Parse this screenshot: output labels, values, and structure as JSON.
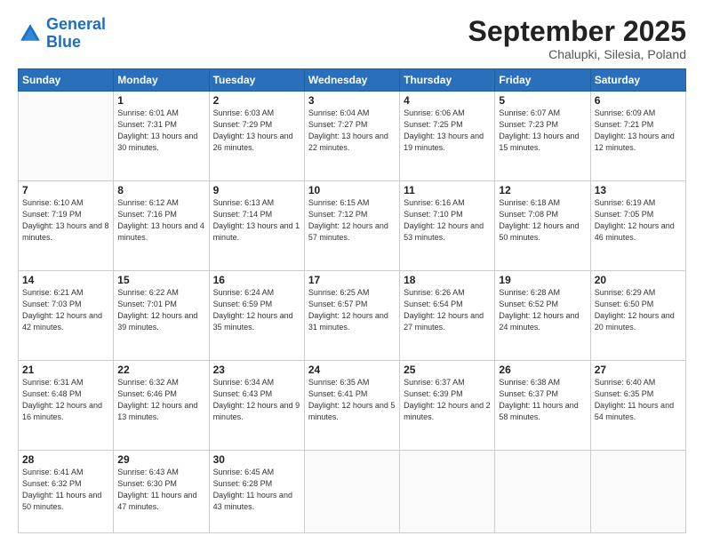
{
  "header": {
    "logo_line1": "General",
    "logo_line2": "Blue",
    "month": "September 2025",
    "location": "Chalupki, Silesia, Poland"
  },
  "weekdays": [
    "Sunday",
    "Monday",
    "Tuesday",
    "Wednesday",
    "Thursday",
    "Friday",
    "Saturday"
  ],
  "weeks": [
    [
      {
        "day": "",
        "sunrise": "",
        "sunset": "",
        "daylight": ""
      },
      {
        "day": "1",
        "sunrise": "Sunrise: 6:01 AM",
        "sunset": "Sunset: 7:31 PM",
        "daylight": "Daylight: 13 hours and 30 minutes."
      },
      {
        "day": "2",
        "sunrise": "Sunrise: 6:03 AM",
        "sunset": "Sunset: 7:29 PM",
        "daylight": "Daylight: 13 hours and 26 minutes."
      },
      {
        "day": "3",
        "sunrise": "Sunrise: 6:04 AM",
        "sunset": "Sunset: 7:27 PM",
        "daylight": "Daylight: 13 hours and 22 minutes."
      },
      {
        "day": "4",
        "sunrise": "Sunrise: 6:06 AM",
        "sunset": "Sunset: 7:25 PM",
        "daylight": "Daylight: 13 hours and 19 minutes."
      },
      {
        "day": "5",
        "sunrise": "Sunrise: 6:07 AM",
        "sunset": "Sunset: 7:23 PM",
        "daylight": "Daylight: 13 hours and 15 minutes."
      },
      {
        "day": "6",
        "sunrise": "Sunrise: 6:09 AM",
        "sunset": "Sunset: 7:21 PM",
        "daylight": "Daylight: 13 hours and 12 minutes."
      }
    ],
    [
      {
        "day": "7",
        "sunrise": "Sunrise: 6:10 AM",
        "sunset": "Sunset: 7:19 PM",
        "daylight": "Daylight: 13 hours and 8 minutes."
      },
      {
        "day": "8",
        "sunrise": "Sunrise: 6:12 AM",
        "sunset": "Sunset: 7:16 PM",
        "daylight": "Daylight: 13 hours and 4 minutes."
      },
      {
        "day": "9",
        "sunrise": "Sunrise: 6:13 AM",
        "sunset": "Sunset: 7:14 PM",
        "daylight": "Daylight: 13 hours and 1 minute."
      },
      {
        "day": "10",
        "sunrise": "Sunrise: 6:15 AM",
        "sunset": "Sunset: 7:12 PM",
        "daylight": "Daylight: 12 hours and 57 minutes."
      },
      {
        "day": "11",
        "sunrise": "Sunrise: 6:16 AM",
        "sunset": "Sunset: 7:10 PM",
        "daylight": "Daylight: 12 hours and 53 minutes."
      },
      {
        "day": "12",
        "sunrise": "Sunrise: 6:18 AM",
        "sunset": "Sunset: 7:08 PM",
        "daylight": "Daylight: 12 hours and 50 minutes."
      },
      {
        "day": "13",
        "sunrise": "Sunrise: 6:19 AM",
        "sunset": "Sunset: 7:05 PM",
        "daylight": "Daylight: 12 hours and 46 minutes."
      }
    ],
    [
      {
        "day": "14",
        "sunrise": "Sunrise: 6:21 AM",
        "sunset": "Sunset: 7:03 PM",
        "daylight": "Daylight: 12 hours and 42 minutes."
      },
      {
        "day": "15",
        "sunrise": "Sunrise: 6:22 AM",
        "sunset": "Sunset: 7:01 PM",
        "daylight": "Daylight: 12 hours and 39 minutes."
      },
      {
        "day": "16",
        "sunrise": "Sunrise: 6:24 AM",
        "sunset": "Sunset: 6:59 PM",
        "daylight": "Daylight: 12 hours and 35 minutes."
      },
      {
        "day": "17",
        "sunrise": "Sunrise: 6:25 AM",
        "sunset": "Sunset: 6:57 PM",
        "daylight": "Daylight: 12 hours and 31 minutes."
      },
      {
        "day": "18",
        "sunrise": "Sunrise: 6:26 AM",
        "sunset": "Sunset: 6:54 PM",
        "daylight": "Daylight: 12 hours and 27 minutes."
      },
      {
        "day": "19",
        "sunrise": "Sunrise: 6:28 AM",
        "sunset": "Sunset: 6:52 PM",
        "daylight": "Daylight: 12 hours and 24 minutes."
      },
      {
        "day": "20",
        "sunrise": "Sunrise: 6:29 AM",
        "sunset": "Sunset: 6:50 PM",
        "daylight": "Daylight: 12 hours and 20 minutes."
      }
    ],
    [
      {
        "day": "21",
        "sunrise": "Sunrise: 6:31 AM",
        "sunset": "Sunset: 6:48 PM",
        "daylight": "Daylight: 12 hours and 16 minutes."
      },
      {
        "day": "22",
        "sunrise": "Sunrise: 6:32 AM",
        "sunset": "Sunset: 6:46 PM",
        "daylight": "Daylight: 12 hours and 13 minutes."
      },
      {
        "day": "23",
        "sunrise": "Sunrise: 6:34 AM",
        "sunset": "Sunset: 6:43 PM",
        "daylight": "Daylight: 12 hours and 9 minutes."
      },
      {
        "day": "24",
        "sunrise": "Sunrise: 6:35 AM",
        "sunset": "Sunset: 6:41 PM",
        "daylight": "Daylight: 12 hours and 5 minutes."
      },
      {
        "day": "25",
        "sunrise": "Sunrise: 6:37 AM",
        "sunset": "Sunset: 6:39 PM",
        "daylight": "Daylight: 12 hours and 2 minutes."
      },
      {
        "day": "26",
        "sunrise": "Sunrise: 6:38 AM",
        "sunset": "Sunset: 6:37 PM",
        "daylight": "Daylight: 11 hours and 58 minutes."
      },
      {
        "day": "27",
        "sunrise": "Sunrise: 6:40 AM",
        "sunset": "Sunset: 6:35 PM",
        "daylight": "Daylight: 11 hours and 54 minutes."
      }
    ],
    [
      {
        "day": "28",
        "sunrise": "Sunrise: 6:41 AM",
        "sunset": "Sunset: 6:32 PM",
        "daylight": "Daylight: 11 hours and 50 minutes."
      },
      {
        "day": "29",
        "sunrise": "Sunrise: 6:43 AM",
        "sunset": "Sunset: 6:30 PM",
        "daylight": "Daylight: 11 hours and 47 minutes."
      },
      {
        "day": "30",
        "sunrise": "Sunrise: 6:45 AM",
        "sunset": "Sunset: 6:28 PM",
        "daylight": "Daylight: 11 hours and 43 minutes."
      },
      {
        "day": "",
        "sunrise": "",
        "sunset": "",
        "daylight": ""
      },
      {
        "day": "",
        "sunrise": "",
        "sunset": "",
        "daylight": ""
      },
      {
        "day": "",
        "sunrise": "",
        "sunset": "",
        "daylight": ""
      },
      {
        "day": "",
        "sunrise": "",
        "sunset": "",
        "daylight": ""
      }
    ]
  ]
}
